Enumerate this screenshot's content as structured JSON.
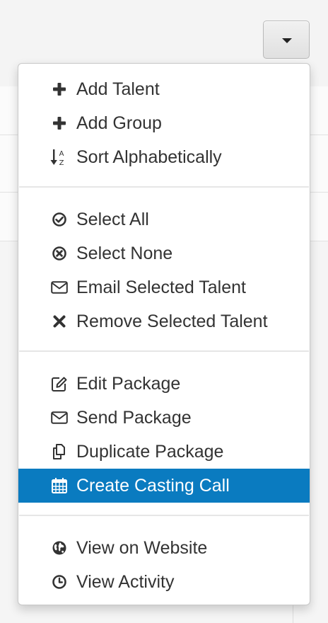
{
  "dropdown": {
    "toggle": {
      "icon": "caret-down-icon"
    },
    "groups": [
      {
        "items": [
          {
            "label": "Add Talent",
            "icon": "plus-icon"
          },
          {
            "label": "Add Group",
            "icon": "plus-icon"
          },
          {
            "label": "Sort Alphabetically",
            "icon": "sort-alpha-icon"
          }
        ]
      },
      {
        "items": [
          {
            "label": "Select All",
            "icon": "check-circle-icon"
          },
          {
            "label": "Select None",
            "icon": "times-circle-icon"
          },
          {
            "label": "Email Selected Talent",
            "icon": "envelope-icon"
          },
          {
            "label": "Remove Selected Talent",
            "icon": "times-icon"
          }
        ]
      },
      {
        "items": [
          {
            "label": "Edit Package",
            "icon": "edit-icon"
          },
          {
            "label": "Send Package",
            "icon": "envelope-icon"
          },
          {
            "label": "Duplicate Package",
            "icon": "copy-icon"
          },
          {
            "label": "Create Casting Call",
            "icon": "calendar-icon",
            "active": true
          }
        ]
      },
      {
        "items": [
          {
            "label": "View on Website",
            "icon": "globe-icon"
          },
          {
            "label": "View Activity",
            "icon": "clock-icon"
          }
        ]
      }
    ]
  },
  "colors": {
    "active_background": "#0a7bc0",
    "active_text": "#ffffff",
    "text": "#333333"
  }
}
